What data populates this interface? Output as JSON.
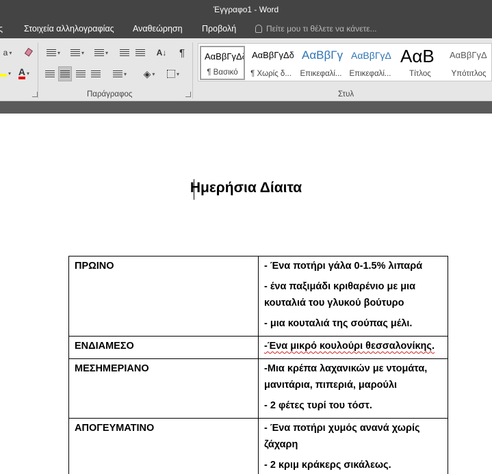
{
  "window": {
    "title": "Έγγραφο1 - Word"
  },
  "tabs": [
    {
      "label": "ς"
    },
    {
      "label": "Στοιχεία αλληλογραφίας"
    },
    {
      "label": "Αναθεώρηση"
    },
    {
      "label": "Προβολή"
    }
  ],
  "tell_me": {
    "placeholder": "Πείτε μου τι θέλετε να κάνετε..."
  },
  "ribbon": {
    "font_group_fragment": "a",
    "paragraph_label": "Παράγραφος",
    "styles_label": "Στυλ",
    "styles": [
      {
        "preview": "ΑαΒβΓγΔδ",
        "name": "¶ Βασικό",
        "color": "#000000"
      },
      {
        "preview": "ΑαΒβΓγΔδ",
        "name": "¶ Χωρίς δ...",
        "color": "#000000"
      },
      {
        "preview": "ΑαΒβΓγ",
        "name": "Επικεφαλί...",
        "color": "#2e74b5"
      },
      {
        "preview": "ΑαΒβΓγΔ",
        "name": "Επικεφαλί...",
        "color": "#2e74b5"
      },
      {
        "preview": "ΑαΒ",
        "name": "Τίτλος",
        "color": "#000000"
      },
      {
        "preview": "ΑαΒβΓγΔ",
        "name": "Υπότιτλος",
        "color": "#5a5a5a"
      }
    ]
  },
  "colors": {
    "titlebar": "#444444",
    "ribbon": "#e6e6e6",
    "highlight": "#ffff00",
    "font_color": "#e00000"
  },
  "document": {
    "title": "Ημερήσια Δίαιτα",
    "table": [
      {
        "meal": "ΠΡΩΙΝΟ",
        "items": [
          "- Ένα ποτήρι γάλα 0-1.5% λιπαρά",
          "- ένα παξιμάδι κριθαρένιο με μια κουταλιά του γλυκού βούτυρο",
          "- μια κουταλιά της σούπας μέλι."
        ]
      },
      {
        "meal": "ΕΝΔΙΑΜΕΣΟ",
        "items": [
          "-Ένα μικρό κουλούρι θεσσαλονίκης."
        ]
      },
      {
        "meal": "ΜΕΣΗΜΕΡΙΑΝΟ",
        "items": [
          "-Μια κρέπα λαχανικών με ντομάτα, μανιτάρια, πιπεριά, μαρούλι",
          "- 2 φέτες τυρί του τόστ."
        ]
      },
      {
        "meal": "ΑΠΟΓΕΥΜΑΤΙΝΟ",
        "items": [
          "- Ένα ποτήρι χυμός ανανά χωρίς ζάχαρη",
          "- 2 κριμ κράκερς σικάλεως."
        ]
      }
    ]
  }
}
